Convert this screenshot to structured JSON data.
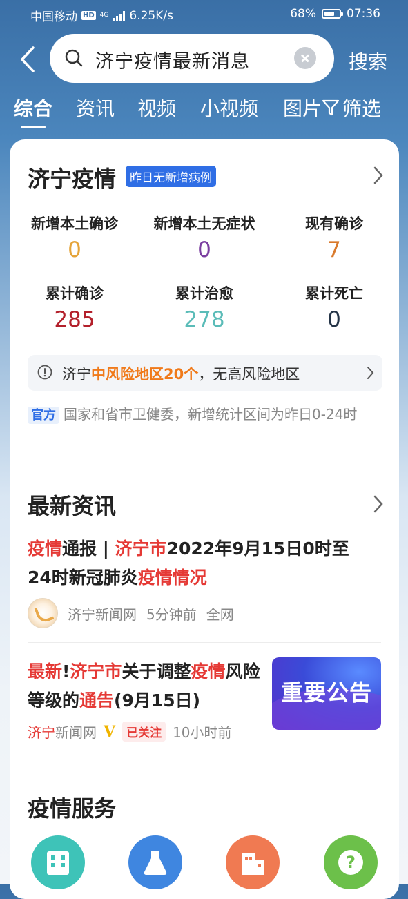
{
  "status_bar": {
    "carrier": "中国移动",
    "hd": "HD",
    "network": "4G",
    "speed": "6.25K/s",
    "battery": "68%",
    "battery_level": 0.68,
    "time": "07:36"
  },
  "search": {
    "query": "济宁疫情最新消息",
    "button": "搜索"
  },
  "tabs": [
    "综合",
    "资讯",
    "视频",
    "小视频",
    "图片"
  ],
  "active_tab": 0,
  "filter_label": "筛选",
  "epidemic": {
    "title": "济宁疫情",
    "badge": "昨日无新增病例",
    "stats": [
      {
        "label": "新增本土确诊",
        "value": "0",
        "color": "#e5a43a"
      },
      {
        "label": "新增本土无症状",
        "value": "0",
        "color": "#7b3fa0"
      },
      {
        "label": "现有确诊",
        "value": "7",
        "color": "#d9792b"
      },
      {
        "label": "累计确诊",
        "value": "285",
        "color": "#b3202b"
      },
      {
        "label": "累计治愈",
        "value": "278",
        "color": "#5bbcb8"
      },
      {
        "label": "累计死亡",
        "value": "0",
        "color": "#243447"
      }
    ],
    "risk": {
      "prefix": "济宁",
      "highlight": "中风险地区20个",
      "suffix": "，无高风险地区"
    },
    "source": {
      "tag": "官方",
      "text": "国家和省市卫健委，新增统计区间为昨日0-24时"
    }
  },
  "news": {
    "title": "最新资讯",
    "items": [
      {
        "title_parts": [
          {
            "text": "疫情",
            "red": true
          },
          {
            "text": "通报 | ",
            "red": false
          },
          {
            "text": "济宁市",
            "red": true
          },
          {
            "text": "2022年9月15日0时至24时新冠肺炎",
            "red": false
          },
          {
            "text": "疫情情况",
            "red": true
          }
        ],
        "source": "济宁新闻网",
        "time": "5分钟前",
        "scope": "全网"
      },
      {
        "title_parts": [
          {
            "text": "最新",
            "red": true
          },
          {
            "text": "!",
            "red": false
          },
          {
            "text": "济宁市",
            "red": true
          },
          {
            "text": "关于调整",
            "red": false
          },
          {
            "text": "疫情",
            "red": true
          },
          {
            "text": "风险等级的",
            "red": false
          },
          {
            "text": "通告",
            "red": true
          },
          {
            "text": "(9月15日)",
            "red": false
          }
        ],
        "source_red": "济宁",
        "source_rest": "新闻网",
        "verified": "V",
        "followed": "已关注",
        "time": "10小时前",
        "thumbnail_text": "重要公告"
      }
    ]
  },
  "services": {
    "title": "疫情服务",
    "icons": [
      {
        "name": "building-icon",
        "color": "#3ec3b8"
      },
      {
        "name": "flask-icon",
        "color": "#3f86e0"
      },
      {
        "name": "hospital-icon",
        "color": "#f07a52"
      },
      {
        "name": "question-icon",
        "color": "#6cc04a"
      }
    ]
  }
}
